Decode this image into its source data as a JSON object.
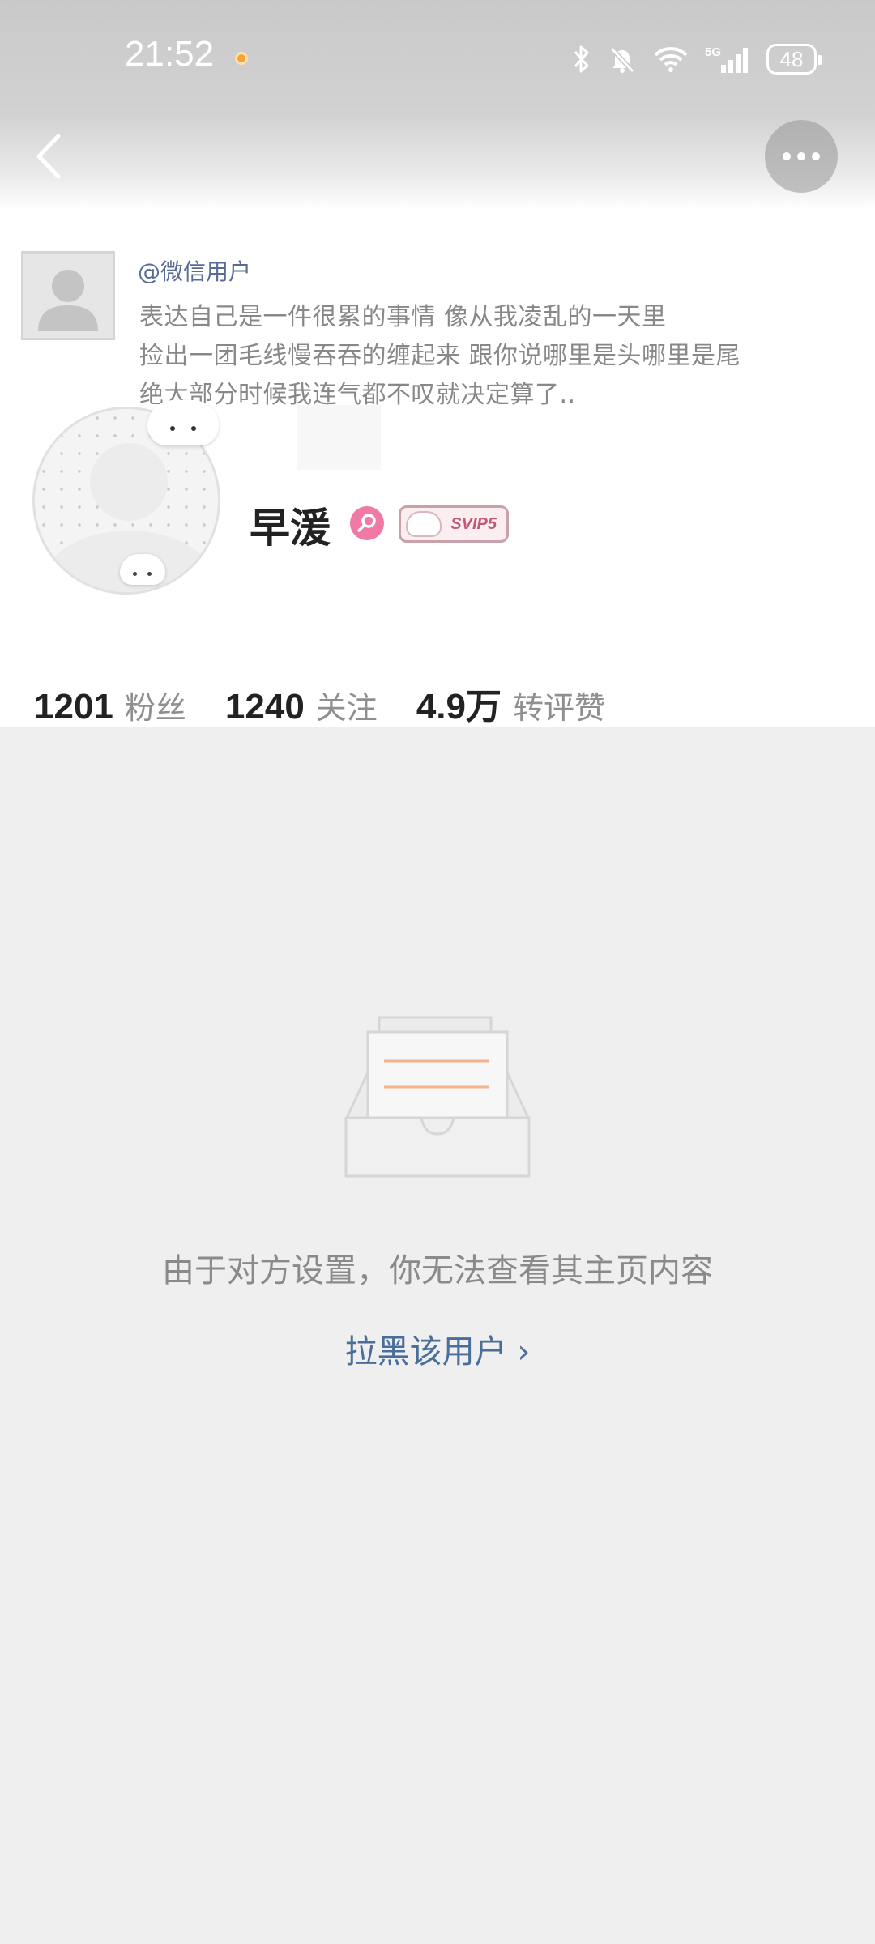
{
  "status_bar": {
    "time": "21:52",
    "battery": "48",
    "icons": [
      "bluetooth-icon",
      "mute-bell-icon",
      "wifi-icon",
      "5g-signal-icon",
      "battery-icon"
    ]
  },
  "nav": {
    "back_icon": "chevron-left-icon",
    "more_icon": "more-dots-icon"
  },
  "cover_quote": {
    "user": "@微信用户",
    "lines": [
      "表达自己是一件很累的事情 像从我凌乱的一天里",
      "捡出一团毛线慢吞吞的缠起来 跟你说哪里是头哪里是尾",
      "绝大部分时候我连气都不叹就决定算了.."
    ]
  },
  "profile": {
    "name": "早湲",
    "gender_color": "#f07aa4",
    "vip_badge": "SVIP5"
  },
  "stats": [
    {
      "value": "1201",
      "label": "粉丝"
    },
    {
      "value": "1240",
      "label": "关注"
    },
    {
      "value": "4.9万",
      "label": "转评赞"
    }
  ],
  "empty_state": {
    "icon": "empty-inbox-icon",
    "message": "由于对方设置，你无法查看其主页内容",
    "block_link": "拉黑该用户 ›"
  },
  "colors": {
    "link": "#4a6e9a",
    "page_bg": "#efefef",
    "accent_orange": "#f4b48a"
  }
}
